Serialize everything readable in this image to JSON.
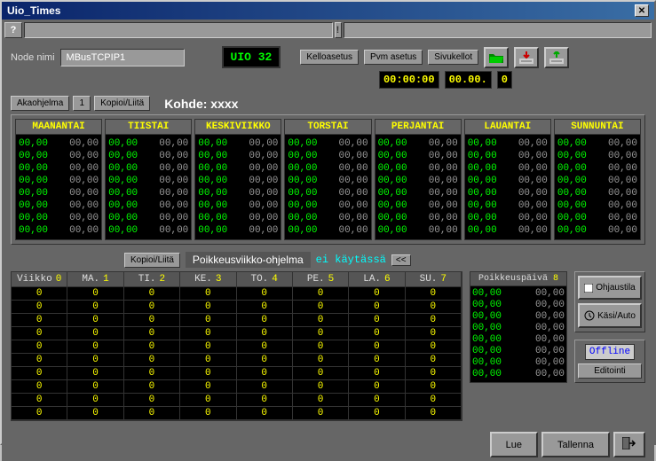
{
  "window": {
    "title": "Uio_Times"
  },
  "toolbar": {
    "node_label": "Node nimi",
    "node_value": "MBusTCPIP1",
    "uio": "UIO 32",
    "btn_clock": "Kelloasetus",
    "btn_date": "Pvm asetus",
    "btn_pages": "Sivukellot",
    "clock_time": "00:00:00",
    "clock_date": "00.00.",
    "clock_year": "0"
  },
  "tabs": {
    "akaohjelma": "Akaohjelma",
    "akaohjelma_num": "1",
    "kopioi": "Kopioi/Liitä",
    "kohde_label": "Kohde:",
    "kohde_value": "xxxx"
  },
  "days": [
    {
      "name": "MAANANTAI"
    },
    {
      "name": "TIISTAI"
    },
    {
      "name": "KESKIVIIKKO"
    },
    {
      "name": "TORSTAI"
    },
    {
      "name": "PERJANTAI"
    },
    {
      "name": "LAUANTAI"
    },
    {
      "name": "SUNNUNTAI"
    }
  ],
  "day_time_rows": 8,
  "day_time_value": "00,00",
  "exception": {
    "kopioi": "Kopioi/Liitä",
    "title": "Poikkeusviikko-ohjelma",
    "state": "ei käytässä",
    "nav": "<<"
  },
  "week_headers": [
    {
      "l": "Viikko",
      "n": "0"
    },
    {
      "l": "MA.",
      "n": "1"
    },
    {
      "l": "TI.",
      "n": "2"
    },
    {
      "l": "KE.",
      "n": "3"
    },
    {
      "l": "TO.",
      "n": "4"
    },
    {
      "l": "PE.",
      "n": "5"
    },
    {
      "l": "LA.",
      "n": "6"
    },
    {
      "l": "SU.",
      "n": "7"
    }
  ],
  "week_rows": 10,
  "week_cell": "0",
  "pk_header_label": "Poikkeuspäivä",
  "pk_header_num": "8",
  "pk_rows": 8,
  "pk_value": "00,00",
  "side": {
    "ohjaustila": "Ohjaustila",
    "kasiauto": "Käsi/Auto",
    "offline": "Offline",
    "editointi": "Editointi"
  },
  "footer": {
    "lue": "Lue",
    "tallenna": "Tallenna"
  }
}
